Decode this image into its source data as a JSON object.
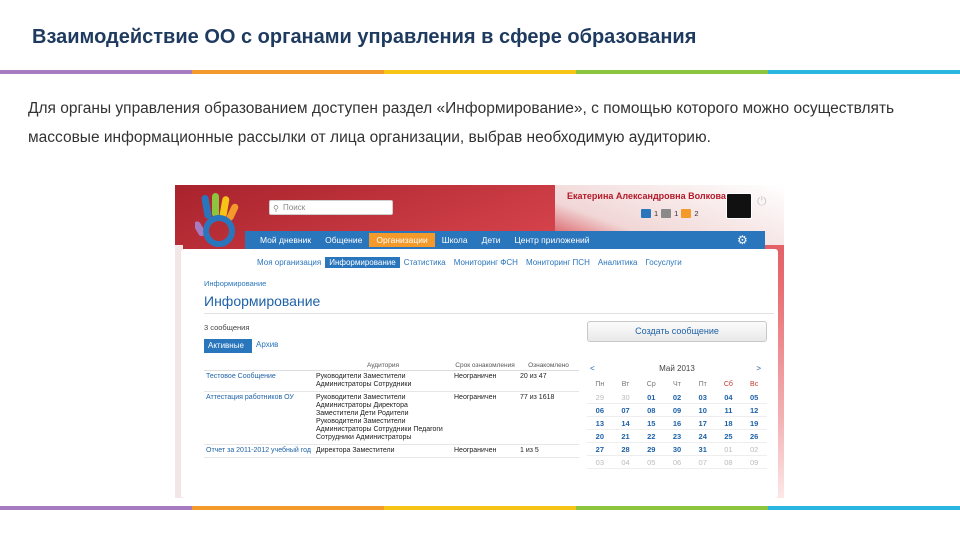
{
  "slide": {
    "title": "Взаимодействие ОО с органами управления в сфере образования",
    "paragraph": "Для органы управления образованием доступен раздел «Информирование», с помощью которого можно осуществлять массовые информационные рассылки от лица организации, выбрав необходимую аудиторию.",
    "stripe_colors": [
      "#a77bc2",
      "#f39a2a",
      "#f5c416",
      "#8cc63f",
      "#29b6e0"
    ]
  },
  "app": {
    "user_name": "Екатерина Александровна Волкова",
    "search_placeholder": "Поиск",
    "header_counts": [
      "1",
      "1",
      "2"
    ],
    "main_nav": [
      {
        "label": "Мой дневник",
        "active": false
      },
      {
        "label": "Общение",
        "active": false
      },
      {
        "label": "Организации",
        "active": true
      },
      {
        "label": "Школа",
        "active": false
      },
      {
        "label": "Дети",
        "active": false
      },
      {
        "label": "Центр приложений",
        "active": false
      }
    ],
    "sub_nav": [
      {
        "label": "Моя организация",
        "active": false
      },
      {
        "label": "Информирование",
        "active": true
      },
      {
        "label": "Статистика",
        "active": false
      },
      {
        "label": "Мониторинг ФСН",
        "active": false
      },
      {
        "label": "Мониторинг ПСН",
        "active": false
      },
      {
        "label": "Аналитика",
        "active": false
      },
      {
        "label": "Госуслуги",
        "active": false
      }
    ],
    "breadcrumb": "Информирование",
    "page_title": "Информирование",
    "messages_label": "3 сообщения",
    "create_button": "Создать сообщение",
    "tabs": {
      "active": "Активные",
      "archive": "Архив"
    },
    "table": {
      "columns": [
        "",
        "Аудитория",
        "Срок ознакомления",
        "Ознакомлено"
      ],
      "rows": [
        {
          "name": "Тестовое Сообщение",
          "audience": "Руководители Заместители Администраторы Сотрудники",
          "term": "Неограничен",
          "read": "20 из 47"
        },
        {
          "name": "Аттестация работников ОУ",
          "audience": "Руководители Заместители Администраторы Директора Заместители Дети Родители Руководители Заместители Администраторы Сотрудники Педагоги Сотрудники Администраторы",
          "term": "Неограничен",
          "read": "77 из 1618"
        },
        {
          "name": "Отчет за 2011-2012 учебный год",
          "audience": "Директора Заместители",
          "term": "Неограничен",
          "read": "1 из 5"
        }
      ]
    },
    "calendar": {
      "prev": "<",
      "month": "Май 2013",
      "next": ">",
      "weekdays": [
        "Пн",
        "Вт",
        "Ср",
        "Чт",
        "Пт",
        "Сб",
        "Вс"
      ],
      "weeks": [
        [
          "29",
          "30",
          "01",
          "02",
          "03",
          "04",
          "05"
        ],
        [
          "06",
          "07",
          "08",
          "09",
          "10",
          "11",
          "12"
        ],
        [
          "13",
          "14",
          "15",
          "16",
          "17",
          "18",
          "19"
        ],
        [
          "20",
          "21",
          "22",
          "23",
          "24",
          "25",
          "26"
        ],
        [
          "27",
          "28",
          "29",
          "30",
          "31",
          "01",
          "02"
        ],
        [
          "03",
          "04",
          "05",
          "06",
          "07",
          "08",
          "09"
        ]
      ],
      "other_month_flags": [
        [
          true,
          true,
          false,
          false,
          false,
          false,
          false
        ],
        [
          false,
          false,
          false,
          false,
          false,
          false,
          false
        ],
        [
          false,
          false,
          false,
          false,
          false,
          false,
          false
        ],
        [
          false,
          false,
          false,
          false,
          false,
          false,
          false
        ],
        [
          false,
          false,
          false,
          false,
          false,
          true,
          true
        ],
        [
          true,
          true,
          true,
          true,
          true,
          true,
          true
        ]
      ]
    }
  }
}
